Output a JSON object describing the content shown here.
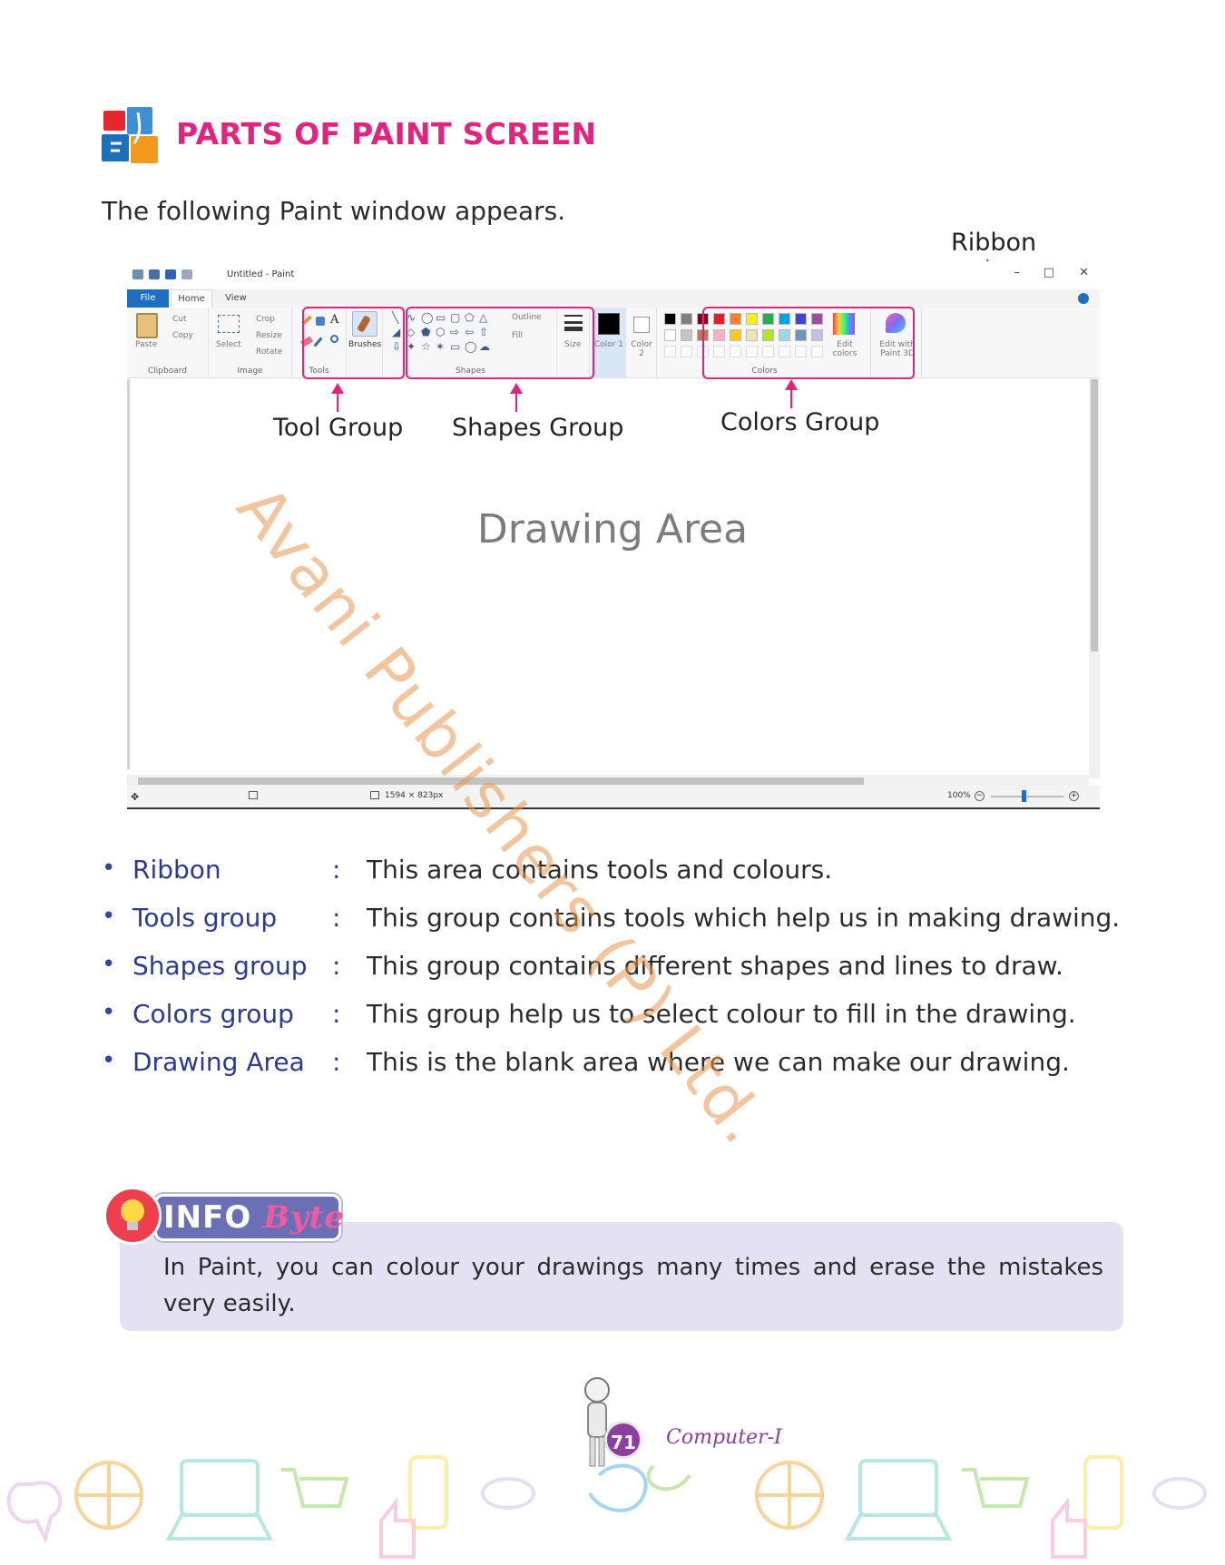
{
  "heading": {
    "title": "PARTS OF PAINT SCREEN",
    "intro": "The following Paint window appears."
  },
  "callouts": {
    "ribbon": "Ribbon",
    "tool_group": "Tool Group",
    "shapes_group": "Shapes Group",
    "colors_group": "Colors Group",
    "drawing_area": "Drawing Area"
  },
  "paint_window": {
    "title": "Untitled - Paint",
    "menu": {
      "file": "File",
      "home": "Home",
      "view": "View"
    },
    "ribbon": {
      "clipboard": {
        "paste": "Paste",
        "cut": "Cut",
        "copy": "Copy",
        "label": "Clipboard"
      },
      "image": {
        "select": "Select",
        "crop": "Crop",
        "resize": "Resize",
        "rotate": "Rotate",
        "label": "Image"
      },
      "tools": {
        "label": "Tools",
        "brushes": "Brushes"
      },
      "shapes": {
        "label": "Shapes",
        "outline": "Outline",
        "fill": "Fill"
      },
      "size": "Size",
      "color1": "Color 1",
      "color2": "Color 2",
      "colors": {
        "label": "Colors",
        "edit": "Edit colors"
      },
      "paint3d": "Edit with Paint 3D"
    },
    "palette_row1": [
      "#000000",
      "#7f7f7f",
      "#880015",
      "#ed1c24",
      "#ff7f27",
      "#fff200",
      "#22b14c",
      "#00a2e8",
      "#3f48cc",
      "#a349a4"
    ],
    "palette_row2": [
      "#ffffff",
      "#c3c3c3",
      "#b97a57",
      "#ffaec9",
      "#ffc90e",
      "#efe4b0",
      "#b5e61d",
      "#99d9ea",
      "#7092be",
      "#c8bfe7"
    ],
    "status": {
      "dimensions": "1594 × 823px",
      "zoom": "100%"
    }
  },
  "definitions": [
    {
      "term": "Ribbon",
      "desc": "This area contains tools and colours."
    },
    {
      "term": "Tools group",
      "desc": "This group contains tools which help us in making drawing."
    },
    {
      "term": "Shapes group",
      "desc": "This group contains different shapes and lines to draw."
    },
    {
      "term": "Colors group",
      "desc": "This group help us to select colour to fill in the drawing."
    },
    {
      "term": "Drawing Area",
      "desc": "This is the blank area where we can make our drawing."
    }
  ],
  "info_byte": {
    "badge_info": "INFO",
    "badge_byte": "Byte",
    "text": "In Paint, you can colour your drawings many times and erase the mistakes very easily."
  },
  "watermark": "Avani Publishers (P) Ltd.",
  "footer": {
    "page": "71",
    "book": "Computer-I"
  },
  "colors": {
    "accent_pink": "#e0247f",
    "term_blue": "#2d3a8f",
    "info_bg": "#e4e2f2",
    "page_badge": "#8d3ea0"
  }
}
